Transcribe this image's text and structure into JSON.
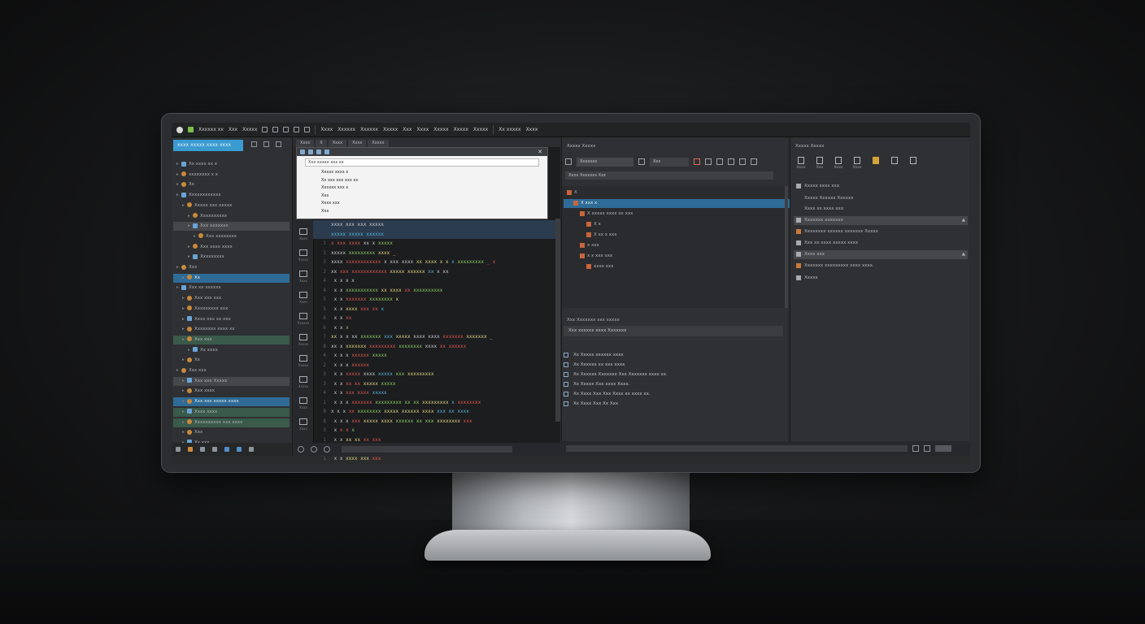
{
  "menubar": {
    "items": [
      "Xxxxxx xx",
      "Xxx",
      "Xxxxx",
      "Xxxx",
      "Xxxxxx",
      "Xxxxxx",
      "Xxxxx",
      "Xxx",
      "Xxxx",
      "Xxxxx",
      "Xxxxx",
      "Xxxxx",
      "Xx xxxxx",
      "Xxxx"
    ]
  },
  "left_panel": {
    "project_button": "xxxx xxxxx  xxxx xxxx",
    "tree": [
      {
        "label": "Xx xxxx   xx x",
        "indent": 0,
        "style": "plain"
      },
      {
        "label": "xxxxxxxx x x",
        "indent": 0,
        "style": "plain"
      },
      {
        "label": "Xx",
        "indent": 0,
        "style": "plain"
      },
      {
        "label": "Xxxxxxxxxxxx",
        "indent": 0,
        "style": "plain"
      },
      {
        "label": "Xxxxx xxx xxxxx",
        "indent": 1,
        "style": "plain"
      },
      {
        "label": "Xxxxxxxxxx",
        "indent": 2,
        "style": "plain"
      },
      {
        "label": "Xxx xxxxxxx",
        "indent": 2,
        "style": "grey"
      },
      {
        "label": "Xxx xxxxxxxx",
        "indent": 3,
        "style": "plain"
      },
      {
        "label": "Xxx xxxx xxxx",
        "indent": 2,
        "style": "plain"
      },
      {
        "label": "Xxxxxxxxx",
        "indent": 2,
        "style": "plain"
      },
      {
        "label": "Xxx",
        "indent": 0,
        "style": "plain"
      },
      {
        "label": "Xx",
        "indent": 1,
        "style": "sel"
      },
      {
        "label": "Xxx xx xxxxxx",
        "indent": 0,
        "style": "plain"
      },
      {
        "label": "Xxx xxx xxx",
        "indent": 1,
        "style": "plain"
      },
      {
        "label": "Xxxxxxxxx xxx",
        "indent": 1,
        "style": "plain"
      },
      {
        "label": "Xxxx xxx xx xxx",
        "indent": 1,
        "style": "plain"
      },
      {
        "label": "Xxxxxxxx xxxx xx",
        "indent": 1,
        "style": "plain"
      },
      {
        "label": "Xxx xxx",
        "indent": 1,
        "style": "green"
      },
      {
        "label": "Xx xxxx",
        "indent": 2,
        "style": "plain"
      },
      {
        "label": "Xx",
        "indent": 1,
        "style": "plain"
      },
      {
        "label": "Xxx xxx",
        "indent": 0,
        "style": "plain"
      },
      {
        "label": "Xxx xxx  Xxxxx",
        "indent": 1,
        "style": "grey"
      },
      {
        "label": "Xxx xxxx",
        "indent": 1,
        "style": "plain"
      },
      {
        "label": "Xxx xxx xxxxx xxxx",
        "indent": 1,
        "style": "sel"
      },
      {
        "label": "Xxxx xxxx",
        "indent": 1,
        "style": "green"
      },
      {
        "label": "Xxxxxxxxxx xxx xxxx",
        "indent": 1,
        "style": "green"
      },
      {
        "label": "Xxx",
        "indent": 1,
        "style": "plain"
      },
      {
        "label": "Xx xxx",
        "indent": 1,
        "style": "plain"
      }
    ]
  },
  "editor": {
    "tabs": [
      "Xxxx",
      "X",
      "Xxxx",
      "Xxxx",
      "Xxxxx"
    ],
    "side_labels": [
      "Xxxx",
      "Xxxxx",
      "Xxxx",
      "Xxxx",
      "Xxxxxx",
      "Xxxxx",
      "Xxxxx",
      "Xxxxx",
      "Xxxx",
      "Xxxx"
    ],
    "popup": {
      "search": "Xxx xxxxx xxx xx",
      "items": [
        "Xxxxx xxxx x",
        "Xx xxx xxx xxx xx",
        "Xxxxxx xxx x",
        "Xxx",
        "Xxxx xxx",
        "Xxx"
      ]
    },
    "code": [
      {
        "n": "",
        "html": "<span class='w'>xxxx xxx xxx xxxxx</span>"
      },
      {
        "n": "",
        "html": "<span class='f'>xxxxx xxxxx xxxxxx</span>"
      },
      {
        "n": "1",
        "html": "<span class='k'>x xxx xxxx</span> <span class='w'>xx x</span> <span class='c'>xxxxx</span>"
      },
      {
        "n": "3",
        "html": "<span class='w'>xxxxx</span> <span class='c'>xxxxxxxxx</span> <span class='s'>xxxx _</span>"
      },
      {
        "n": "3",
        "html": "<span class='w'>xxxx</span> <span class='k'>xxxxxxxxxxxx</span> <span class='w'>x xxx xxxx</span> <span class='s'>xx xxxx x x</span> <span class='f'>x</span> <span class='c'>xxxxxxxxx</span> <span class='k'>_ x</span>"
      },
      {
        "n": "2",
        "html": "<span class='w'>xx</span> <span class='k'>xxx xxxxxxxxxxxx</span> <span class='s'>xxxxx xxxxxx</span> <span class='f'>xx</span> <span class='w'>x xx</span>"
      },
      {
        "n": "4",
        "html": "<span class='w'>  x x x x</span>"
      },
      {
        "n": "4",
        "html": "<span class='w'>   x x</span> <span class='c'>xxxxxxxxxxx</span> <span class='s'>xx xxxx</span> <span class='k'>xx</span> <span class='c'>xxxxxxxxxx</span>"
      },
      {
        "n": "5",
        "html": "<span class='w'>    x x</span> <span class='k'>xxxxxxx</span> <span class='c'>xxxxxxxx</span> <span class='s'>x</span>"
      },
      {
        "n": "5",
        "html": "<span class='w'>      x x</span> <span class='s'>xxxx</span> <span class='k'>xxx xx</span> <span class='f'>x</span>"
      },
      {
        "n": "6",
        "html": "<span class='w'>       x x</span> <span class='k'>xx</span>"
      },
      {
        "n": "6",
        "html": "<span class='w'>     x x</span> <span class='c'>x</span>"
      },
      {
        "n": "7",
        "html": "<span class='s'>xx</span> <span class='w'>x x xx</span> <span class='c'>xxxxxxx</span> <span class='f'>xxx</span> <span class='s'>xxxxx</span> <span class='w'>xxxx xxxx</span> <span class='k'>xxxxxxx</span> <span class='s'>xxxxxxx _</span>"
      },
      {
        "n": "8",
        "html": "<span class='w'>xx x</span> <span class='s'>xxxxxxx</span> <span class='k'>xxxxxxxxx</span> <span class='c'>xxxxxxxx</span> <span class='w'>xxxx</span> <span class='k'>xx xxxxxx</span>"
      },
      {
        "n": "4",
        "html": "<span class='w'>    x  x x</span> <span class='k'>xxxxxx</span> <span class='c'>xxxxx</span>"
      },
      {
        "n": "2",
        "html": "<span class='w'>   x x x</span> <span class='k'>xxxxxx</span>"
      },
      {
        "n": "3",
        "html": "<span class='w'>     x x</span> <span class='k'>xxxxx</span> <span class='w'>xxxx</span> <span class='f'>xxxxx</span> <span class='c'>xxx</span> <span class='s'>xxxxxxxxx</span>"
      },
      {
        "n": "3",
        "html": "<span class='w'>      x x</span> <span class='k'>xx xx</span> <span class='s'>xxxxx</span> <span class='c'>xxxxx</span>"
      },
      {
        "n": "4",
        "html": "<span class='w'>      x x</span> <span class='k'>xxx xxxx</span> <span class='f'>xxxxx</span>"
      },
      {
        "n": "1",
        "html": "<span class='w'>    x x x</span> <span class='k'>xxxxxxx</span> <span class='c'>xxxxxxxxx xx xx</span> <span class='s'>xxxxxxxxx</span> <span class='f'>x</span> <span class='k'>xxxxxxxx</span>"
      },
      {
        "n": "8",
        "html": "<span class='w'>x x x</span> <span class='k'>xx</span> <span class='c'>xxxxxxxx</span> <span class='s'>xxxxx xxxxxx xxxx</span> <span class='f'>xxx xx xxxx</span>"
      },
      {
        "n": "8",
        "html": "<span class='w'>  x x x</span> <span class='k'>xxx</span> <span class='s'>xxxxx xxxx</span> <span class='c'>xxxxxx xx xxx</span> <span class='s'>xxxxxxxx</span> <span class='k'>xxx</span>"
      },
      {
        "n": "3",
        "html": "<span class='w'>   x</span> <span class='k'>x x</span> <span class='c'>x</span>"
      },
      {
        "n": "1",
        "html": "<span class='w'>     x x</span> <span class='s'>xx xx</span> <span class='k'>xx xxx</span>"
      },
      {
        "n": "3",
        "html": "<span class='w'>     x x</span> <span class='c'>xxxxxxx</span> <span class='s'>xxxxx xxx</span>"
      },
      {
        "n": "1",
        "html": "<span class='w'>      x x</span> <span class='s'>xxxx xxx</span> <span class='k'>xxx</span>"
      }
    ]
  },
  "middle_panel": {
    "title": "Xxxxx Xxxxx",
    "dropdown": "Xxxxxxx",
    "dropdown2": "Xxx",
    "filter": "Xxxx  Xxxxxxx  Xxx",
    "tree": [
      {
        "label": "X",
        "indent": 0,
        "style": "plain"
      },
      {
        "label": "X xxx x",
        "indent": 1,
        "style": "sel"
      },
      {
        "label": "X xxxxx xxxx xx xxx",
        "indent": 2,
        "style": "plain"
      },
      {
        "label": "X x",
        "indent": 3,
        "style": "plain"
      },
      {
        "label": "X xx x xxx",
        "indent": 3,
        "style": "plain"
      },
      {
        "label": "x xxx",
        "indent": 2,
        "style": "plain"
      },
      {
        "label": "x x xxx xxx",
        "indent": 2,
        "style": "plain"
      },
      {
        "label": "xxxx xxx",
        "indent": 3,
        "style": "plain"
      }
    ],
    "sub_title": "Xxx  Xxxxxxx xxx xxxxx",
    "sub_bar": "Xxx xxxxxx xxxx Xxxxxxx",
    "checks": [
      "Xx Xxxxx xxxxxx xxxx",
      "Xx Xxxxxx xx xxx xxxx",
      "Xx Xxxxxx Xxxxxxx  Xxx Xxxxxxx xxxx xx.",
      "Xx Xxxxx Xxx xxxx Xxxx.",
      "Xx Xxxx Xxx  Xxx Xxxx xx xxxx xx.",
      "Xx Xxxx Xxx Xx Xxx"
    ]
  },
  "right_panel": {
    "title": "Xxxxx Xxxxx",
    "icon_labels": [
      "Xxxx",
      "Xxx",
      "Xxxx",
      "Xxxx"
    ],
    "rows": [
      {
        "label": "Xxxxx xxxx xxx",
        "style": "plain",
        "icon": "plain"
      },
      {
        "label": "Xxxxx Xxxxxx Xxxxxx",
        "style": "plain",
        "icon": "none"
      },
      {
        "label": "Xxxx xx xxxx xxx",
        "style": "plain",
        "icon": "none"
      },
      {
        "label": "Xxxxxxx xxxxxxx",
        "style": "bar",
        "icon": "plain"
      },
      {
        "label": "Xxxxxxxx xxxxxx xxxxxxx Xxxxx",
        "style": "plain",
        "icon": "o"
      },
      {
        "label": "Xxx xx xxxx xxxxx xxxx",
        "style": "plain",
        "icon": "plain"
      },
      {
        "label": "Xxxx xxx",
        "style": "bar",
        "icon": "plain"
      },
      {
        "label": "Xxxxxxx xxxxxxxxx xxxx xxxx.",
        "style": "plain",
        "icon": "o"
      },
      {
        "label": "Xxxxx",
        "style": "plain",
        "icon": "plain"
      }
    ]
  }
}
